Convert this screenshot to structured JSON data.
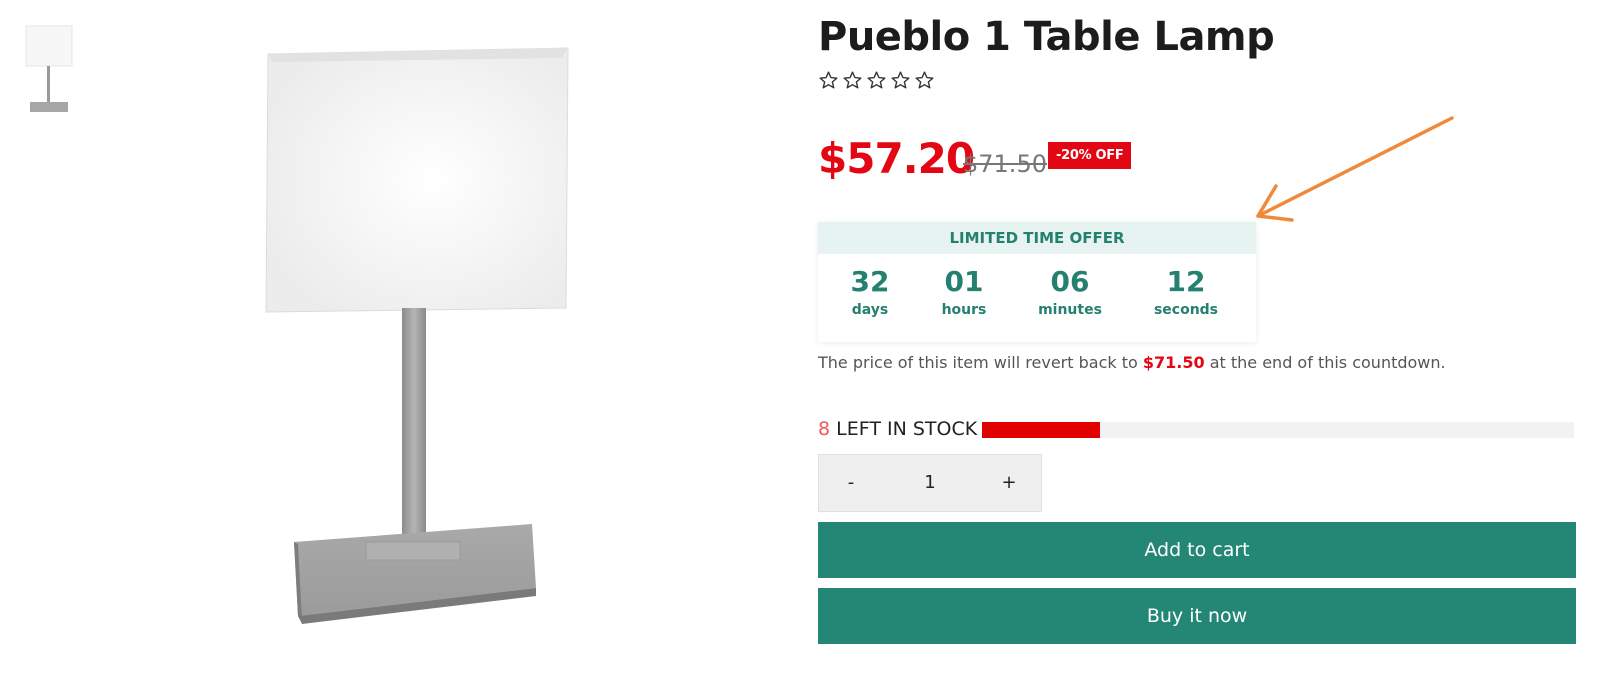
{
  "product": {
    "title": "Pueblo 1 Table Lamp",
    "rating": 0,
    "rating_max": 5
  },
  "price": {
    "current": "$57.20",
    "original": "$71.50",
    "discount_badge": "-20% OFF"
  },
  "countdown": {
    "heading": "LIMITED TIME OFFER",
    "cells": [
      {
        "value": "32",
        "label": "days"
      },
      {
        "value": "01",
        "label": "hours"
      },
      {
        "value": "06",
        "label": "minutes"
      },
      {
        "value": "12",
        "label": "seconds"
      }
    ],
    "notice_before": "The price of this item will revert back to ",
    "notice_price": "$71.50",
    "notice_after": " at the end of this countdown."
  },
  "stock": {
    "count": "8",
    "label": " LEFT IN STOCK",
    "level_fraction": 0.2
  },
  "quantity": {
    "minus": "-",
    "value": "1",
    "plus": "+"
  },
  "actions": {
    "add_to_cart": "Add to cart",
    "buy_now": "Buy it now"
  },
  "colors": {
    "sale_red": "#e30613",
    "brand_green": "#248675",
    "annotation_arrow": "#f08a3a"
  }
}
